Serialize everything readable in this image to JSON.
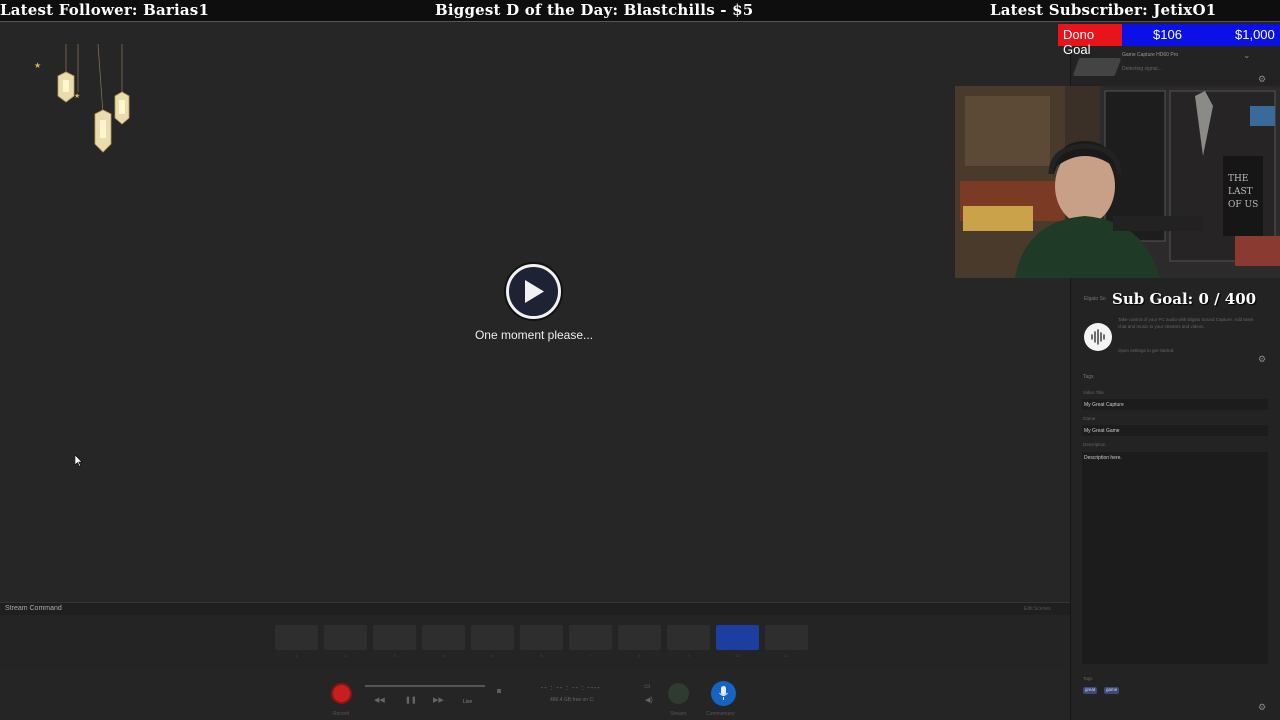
{
  "overlay": {
    "latest_follower": "Latest Follower: Barias1",
    "biggest_donation": "Biggest D of the Day: Blastchills - $5",
    "latest_subscriber": "Latest Subscriber: JetixO1",
    "dono_goal": {
      "label": "Dono Goal",
      "current": "$106",
      "goal": "$1,000"
    },
    "sub_goal": "Sub Goal: 0 / 400"
  },
  "preview": {
    "loading_text": "One moment please..."
  },
  "device": {
    "name": "Game Capture HD60 Pro",
    "status": "Detecting signal..."
  },
  "sound_panel": {
    "title": "Elgato So",
    "description": "Take control of your PC audio with Elgato Sound Capture. Add team chat and music to your streams and videos.",
    "hint": "Open settings to get started."
  },
  "tags": {
    "heading": "Tags",
    "video_title_label": "Video Title",
    "video_title": "My Great Capture",
    "game_label": "Game",
    "game": "My Great Game",
    "description_label": "Description",
    "description": "Description here.",
    "footer_label": "Tags",
    "chips": [
      "great",
      "game"
    ]
  },
  "stream_command": {
    "title": "Stream Command",
    "edit": "Edit Scenes",
    "scene_count": 11,
    "live_scene_index": 9
  },
  "controls": {
    "record_label": "Record",
    "live_label": "Live",
    "time": "-- : -- : -- : ----",
    "storage": "486.4 GB free on C:",
    "stream_label": "Stream",
    "commentary_label": "Commentary"
  },
  "colors": {
    "dono_bar": "#0a10e6",
    "dono_label": "#e8141c",
    "record": "#c81e1e",
    "commentary": "#1565c0"
  }
}
